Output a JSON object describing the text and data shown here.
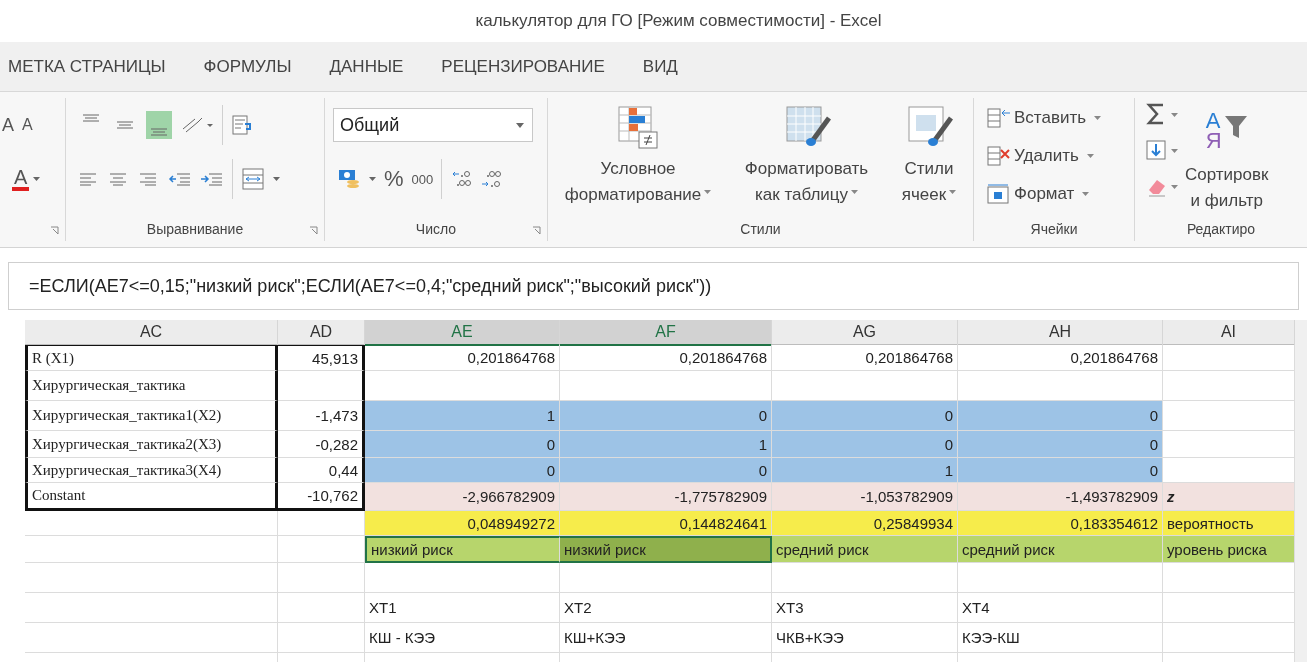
{
  "window": {
    "title": "калькулятор для ГО  [Режим совместимости] - Excel"
  },
  "tabs": [
    {
      "label": "МЕТКА СТРАНИЦЫ"
    },
    {
      "label": "ФОРМУЛЫ"
    },
    {
      "label": "ДАННЫЕ"
    },
    {
      "label": "РЕЦЕНЗИРОВАНИЕ"
    },
    {
      "label": "ВИД"
    }
  ],
  "ribbon": {
    "font_buttons": [
      "A",
      "A",
      "A"
    ],
    "align_buttons": [
      {
        "kind": "top",
        "selected": false
      },
      {
        "kind": "middle",
        "selected": false
      },
      {
        "kind": "bottom",
        "selected": true
      }
    ],
    "alignment_label": "Выравнивание",
    "number": {
      "label": "Число",
      "format": "Общий",
      "percent": "%",
      "thousands": "000"
    },
    "styles": {
      "label": "Стили",
      "buttons": [
        {
          "kind": "conditional",
          "lines": [
            "Условное",
            "форматирование"
          ]
        },
        {
          "kind": "table",
          "lines": [
            "Форматировать",
            "как таблицу"
          ]
        },
        {
          "kind": "cell",
          "lines": [
            "Стили",
            "ячеек"
          ]
        }
      ]
    },
    "cells": {
      "label": "Ячейки",
      "buttons": [
        {
          "kind": "insert",
          "label": "Вставить"
        },
        {
          "kind": "delete",
          "label": "Удалить"
        },
        {
          "kind": "format",
          "label": "Формат"
        }
      ]
    },
    "editing": {
      "label": "Редактиро",
      "sort_letters": [
        "А",
        "Я"
      ],
      "sort": [
        "Сортировк",
        "и фильтр"
      ]
    }
  },
  "formula": "=ЕСЛИ(AE7<=0,15;\"низкий риск\";ЕСЛИ(AE7<=0,4;\"средний риск\";\"высокий риск\"))",
  "columns": [
    {
      "label": "AC",
      "selected": false
    },
    {
      "label": "AD",
      "selected": false
    },
    {
      "label": "AE",
      "selected": true
    },
    {
      "label": "AF",
      "selected": true
    },
    {
      "label": "AG",
      "selected": false
    },
    {
      "label": "AH",
      "selected": false
    },
    {
      "label": "AI",
      "selected": false
    }
  ],
  "rows": [
    {
      "cells": [
        {
          "text": "R (X1)",
          "kind": "label"
        },
        {
          "text": "45,913",
          "kind": "number"
        },
        {
          "text": "0,201864768",
          "kind": "number"
        },
        {
          "text": "0,201864768",
          "kind": "number"
        },
        {
          "text": "0,201864768",
          "kind": "number"
        },
        {
          "text": "0,201864768",
          "kind": "number"
        },
        {}
      ]
    },
    {
      "cells": [
        {
          "text": "Хирургическая_тактика",
          "kind": "label"
        },
        {},
        {},
        {},
        {},
        {},
        {}
      ]
    },
    {
      "cells": [
        {
          "text": "Хирургическая_тактика1(X2)",
          "kind": "label"
        },
        {
          "text": "-1,473",
          "kind": "number"
        },
        {
          "text": "1",
          "kind": "number",
          "color": "#9dc3e6"
        },
        {
          "text": "0",
          "kind": "number",
          "color": "#9dc3e6"
        },
        {
          "text": "0",
          "kind": "number",
          "color": "#9dc3e6"
        },
        {
          "text": "0",
          "kind": "number",
          "color": "#9dc3e6"
        },
        {}
      ]
    },
    {
      "cells": [
        {
          "text": "Хирургическая_тактика2(X3)",
          "kind": "label"
        },
        {
          "text": "-0,282",
          "kind": "number"
        },
        {
          "text": "0",
          "kind": "number",
          "color": "#9dc3e6"
        },
        {
          "text": "1",
          "kind": "number",
          "color": "#9dc3e6"
        },
        {
          "text": "0",
          "kind": "number",
          "color": "#9dc3e6"
        },
        {
          "text": "0",
          "kind": "number",
          "color": "#9dc3e6"
        },
        {}
      ]
    },
    {
      "cells": [
        {
          "text": "Хирургическая_тактика3(X4)",
          "kind": "label"
        },
        {
          "text": "0,44",
          "kind": "number"
        },
        {
          "text": "0",
          "kind": "number",
          "color": "#9dc3e6"
        },
        {
          "text": "0",
          "kind": "number",
          "color": "#9dc3e6"
        },
        {
          "text": "1",
          "kind": "number",
          "color": "#9dc3e6"
        },
        {
          "text": "0",
          "kind": "number",
          "color": "#9dc3e6"
        },
        {}
      ]
    },
    {
      "cells": [
        {
          "text": "Constant",
          "kind": "label"
        },
        {
          "text": "-10,762",
          "kind": "number"
        },
        {
          "text": "-2,966782909",
          "kind": "number",
          "color": "#f2e1df"
        },
        {
          "text": "-1,775782909",
          "kind": "number",
          "color": "#f2e1df"
        },
        {
          "text": "-1,053782909",
          "kind": "number",
          "color": "#f2e1df"
        },
        {
          "text": "-1,493782909",
          "kind": "number",
          "color": "#f2e1df"
        },
        {
          "text": "z",
          "kind": "mark",
          "color": "#f2e1df"
        }
      ]
    },
    {
      "cells": [
        {},
        {},
        {
          "text": "0,048949272",
          "kind": "number",
          "color": "#f6ec4b"
        },
        {
          "text": "0,144824641",
          "kind": "number",
          "color": "#f6ec4b"
        },
        {
          "text": "0,25849934",
          "kind": "number",
          "color": "#f6ec4b"
        },
        {
          "text": "0,183354612",
          "kind": "number",
          "color": "#f6ec4b"
        },
        {
          "text": "вероятность",
          "kind": "text",
          "color": "#f6ec4b"
        }
      ]
    },
    {
      "cells": [
        {
          "selected": false
        },
        {
          "selected": false
        },
        {
          "text": "низкий риск",
          "kind": "text",
          "color": "#b7d56c",
          "selected": true
        },
        {
          "text": "низкий риск",
          "kind": "text",
          "color": "#8fb04c",
          "selected": true
        },
        {
          "text": "средний риск",
          "kind": "text",
          "color": "#b7d56c",
          "selected": false
        },
        {
          "text": "средний риск",
          "kind": "text",
          "color": "#b7d56c",
          "selected": false
        },
        {
          "text": "уровень риска",
          "kind": "text",
          "color": "#b7d56c",
          "selected": false
        }
      ]
    },
    {
      "cells": [
        {},
        {},
        {},
        {},
        {},
        {},
        {}
      ]
    },
    {
      "cells": [
        {},
        {},
        {
          "text": "ХТ1",
          "kind": "text"
        },
        {
          "text": "ХТ2",
          "kind": "text"
        },
        {
          "text": "ХТ3",
          "kind": "text"
        },
        {
          "text": "ХТ4",
          "kind": "text"
        },
        {}
      ]
    },
    {
      "cells": [
        {},
        {},
        {
          "text": "КШ - КЭЭ",
          "kind": "text"
        },
        {
          "text": "КШ+КЭЭ",
          "kind": "text"
        },
        {
          "text": "ЧКВ+КЭЭ",
          "kind": "text"
        },
        {
          "text": "КЭЭ-КШ",
          "kind": "text"
        },
        {}
      ]
    },
    {
      "cells": [
        {},
        {},
        {},
        {},
        {},
        {},
        {}
      ]
    }
  ]
}
